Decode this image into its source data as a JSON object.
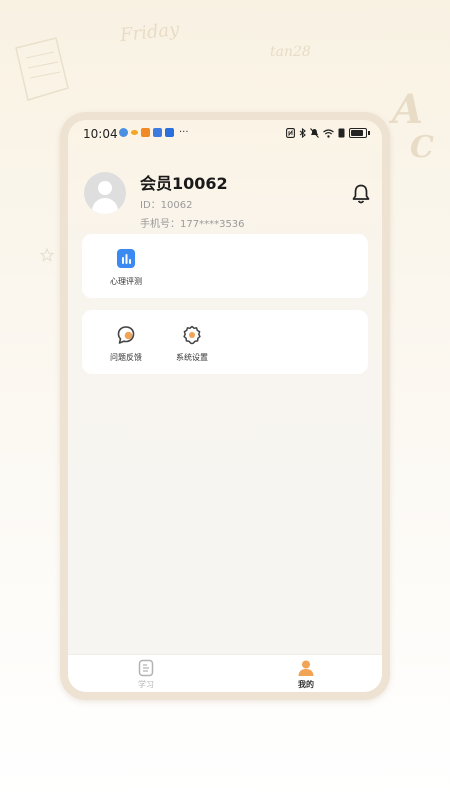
{
  "status_bar": {
    "time": "10:04",
    "more_glyph": "···"
  },
  "profile": {
    "username": "会员10062",
    "id_line": "ID：10062",
    "phone_line": "手机号：177****3536"
  },
  "cards": [
    {
      "items": [
        {
          "label": "心理评测",
          "icon": "chart-icon"
        }
      ]
    },
    {
      "items": [
        {
          "label": "问题反馈",
          "icon": "feedback-icon"
        },
        {
          "label": "系统设置",
          "icon": "gear-icon"
        }
      ]
    }
  ],
  "tab_bar": {
    "tabs": [
      {
        "label": "学习",
        "icon": "book-icon",
        "active": false
      },
      {
        "label": "我的",
        "icon": "user-icon",
        "active": true
      }
    ]
  },
  "colors": {
    "accent_blue": "#3b8af1",
    "accent_orange": "#f1a356",
    "active_tab_text": "#333333",
    "inactive_tab_text": "#b3b3b3"
  }
}
